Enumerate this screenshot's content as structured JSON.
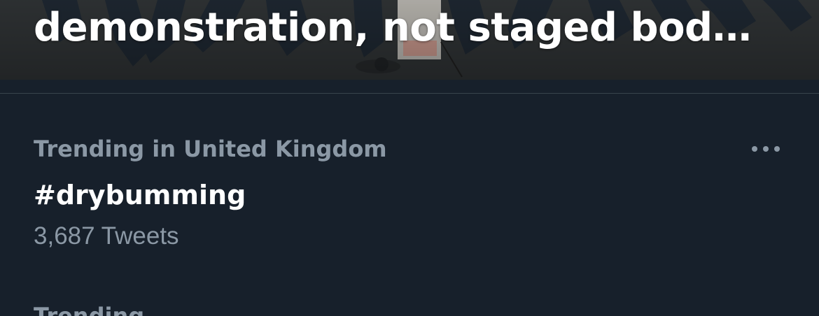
{
  "headline": {
    "title": "demonstration, not staged bod…",
    "image_sign_text": "KLIMA"
  },
  "trend": {
    "context": "Trending in United Kingdom",
    "name": "#drybumming",
    "count": "3,687 Tweets",
    "more_icon": "more-horizontal-icon"
  },
  "next_trend": {
    "context": "Trending"
  },
  "colors": {
    "background": "#17202b",
    "primary_text": "#ffffff",
    "secondary_text": "#8b98a5",
    "divider": "#38444d"
  }
}
